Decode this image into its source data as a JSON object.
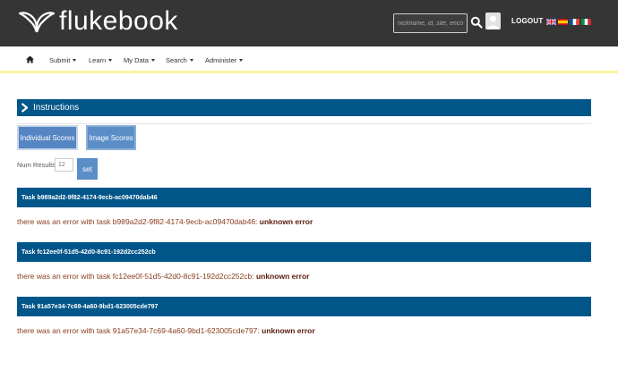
{
  "header": {
    "logo_text": "flukebook",
    "search_placeholder": "nickname, id, site, encou",
    "logout_label": "LOGOUT",
    "flags": [
      "uk-flag-icon",
      "spain-flag-icon",
      "france-flag-icon",
      "italy-flag-icon"
    ]
  },
  "nav": {
    "items": [
      {
        "label": "Submit"
      },
      {
        "label": "Learn"
      },
      {
        "label": "My Data"
      },
      {
        "label": "Search"
      },
      {
        "label": "Administer"
      }
    ]
  },
  "instructions": {
    "label": "Instructions"
  },
  "tabs": {
    "individual_scores": "Individual Scores",
    "image_scores": "Image Scores"
  },
  "results": {
    "label": "Num Results:",
    "value": "12",
    "set_label": "set"
  },
  "tasks": [
    {
      "title": "Task b989a2d2-9f82-4174-9ecb-ac09470dab46",
      "message": "there was an error with task b989a2d2-9f82-4174-9ecb-ac09470dab46: ",
      "error": "unknown error"
    },
    {
      "title": "Task fc12ee0f-51d5-42d0-8c91-192d2cc252cb",
      "message": "there was an error with task fc12ee0f-51d5-42d0-8c91-192d2cc252cb: ",
      "error": "unknown error"
    },
    {
      "title": "Task 91a57e34-7c69-4a60-9bd1-623005cde797",
      "message": "there was an error with task 91a57e34-7c69-4a60-9bd1-623005cde797: ",
      "error": "unknown error"
    }
  ],
  "colors": {
    "header_bg": "#353535",
    "bar_blue": "#005589",
    "button_blue": "#5b8ec7",
    "error_text": "#8a3c1c",
    "nav_underline": "#fbf5a2"
  }
}
